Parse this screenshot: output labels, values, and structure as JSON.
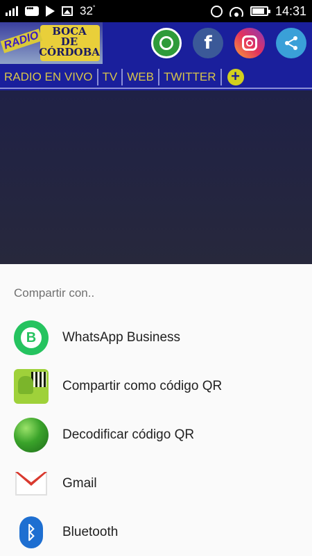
{
  "status_bar": {
    "temperature": "32",
    "temperature_unit": "°",
    "time": "14:31"
  },
  "app": {
    "logo": {
      "radio_text": "RADIO",
      "name_line1": "BOCA",
      "name_line2": "DE",
      "name_line3": "CÓRDOBA"
    },
    "social": {
      "facebook_glyph": "f",
      "share_glyph": "<"
    },
    "nav_tabs": [
      "RADIO EN VIVO",
      "TV",
      "WEB",
      "TWITTER"
    ],
    "nav_more": "+"
  },
  "share_sheet": {
    "title": "Compartir con..",
    "items": [
      {
        "label": "WhatsApp Business",
        "icon": "whatsapp-business-icon",
        "icon_glyph": "B"
      },
      {
        "label": "Compartir como código QR",
        "icon": "qr-share-icon"
      },
      {
        "label": "Decodificar código QR",
        "icon": "globe-icon"
      },
      {
        "label": "Gmail",
        "icon": "gmail-icon"
      },
      {
        "label": "Bluetooth",
        "icon": "bluetooth-icon",
        "icon_glyph": "ᛒ"
      }
    ]
  },
  "colors": {
    "header_bg": "#1a1f9c",
    "nav_text": "#d8c54a",
    "sheet_bg": "#fafafa",
    "whatsapp_green": "#25c35f"
  }
}
